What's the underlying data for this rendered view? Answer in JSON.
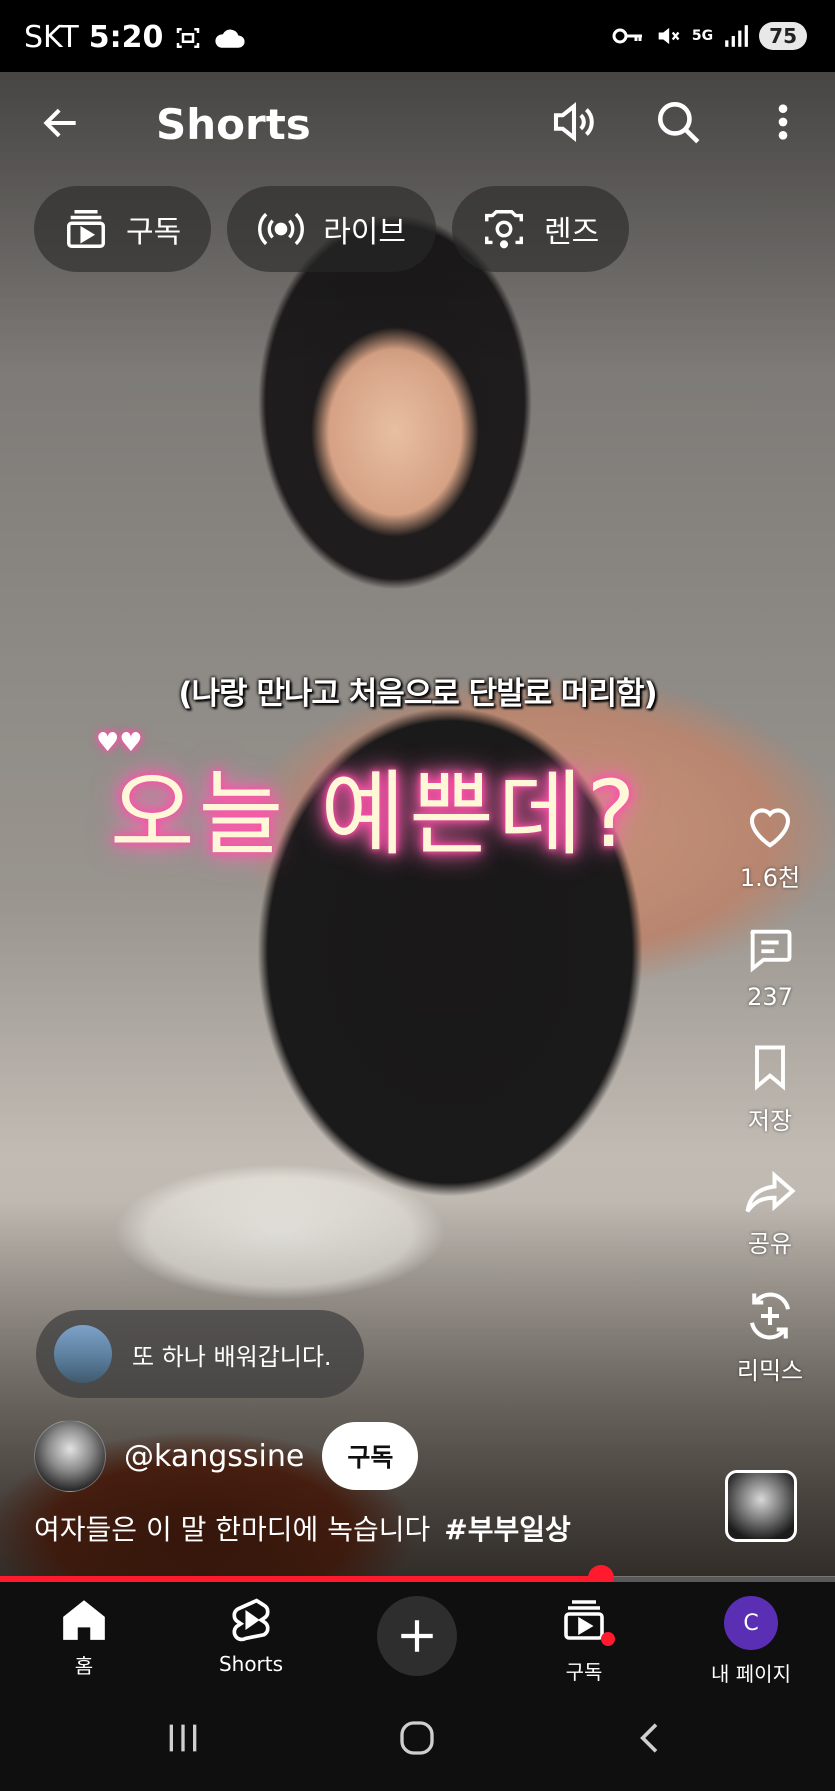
{
  "status_bar": {
    "carrier": "SKT",
    "time": "5:20",
    "network": "5G",
    "battery": "75"
  },
  "header": {
    "title": "Shorts"
  },
  "chips": [
    {
      "label": "구독",
      "icon": "subscriptions-icon"
    },
    {
      "label": "라이브",
      "icon": "live-icon"
    },
    {
      "label": "렌즈",
      "icon": "lens-camera-icon"
    }
  ],
  "video": {
    "caption_small": "(나랑 만나고 처음으로 단발로 머리함)",
    "caption_big": "오늘 예쁜데?"
  },
  "actions": {
    "like_count": "1.6천",
    "comment_count": "237",
    "save_label": "저장",
    "share_label": "공유",
    "remix_label": "리믹스"
  },
  "comment_preview": {
    "text": "또 하나 배워갑니다."
  },
  "channel": {
    "handle": "@kangssine",
    "subscribe_label": "구독"
  },
  "description": {
    "text": "여자들은 이 말 한마디에 녹습니다",
    "hashtag": "#부부일상"
  },
  "progress": {
    "fraction": 0.72,
    "color": "#ff1a2e"
  },
  "bottom_nav": {
    "home": "홈",
    "shorts": "Shorts",
    "subscriptions": "구독",
    "my_page": "내 페이지",
    "avatar_initial": "C"
  }
}
